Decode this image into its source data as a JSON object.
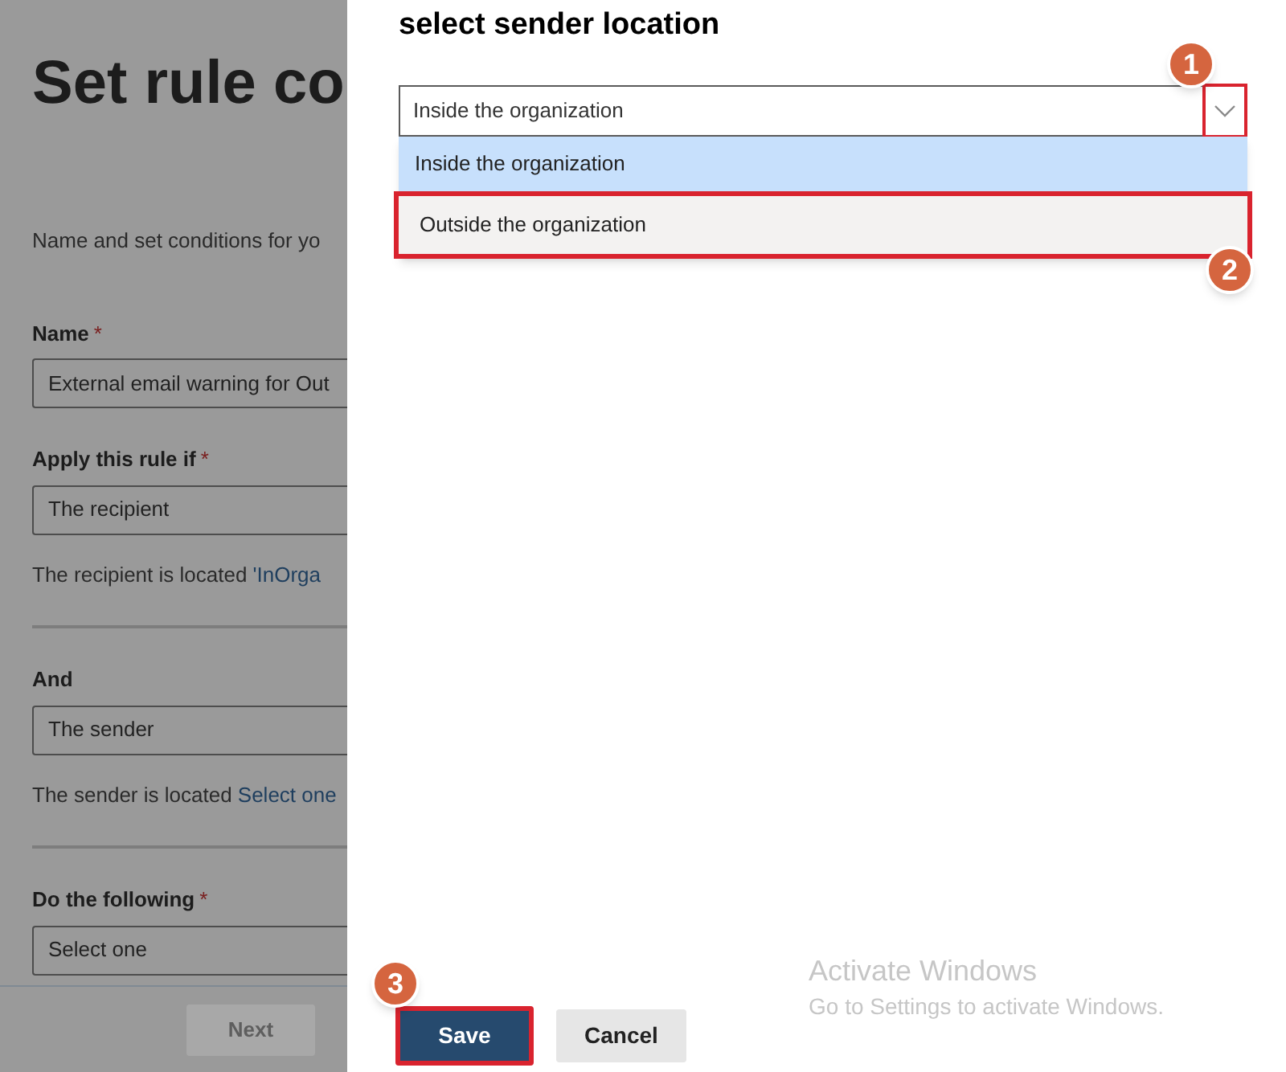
{
  "background_page": {
    "title": "Set rule co",
    "description": "Name and set conditions for yo",
    "required_mark": "*",
    "fields": [
      {
        "label": "Name",
        "required": true,
        "value": "External email warning for Out",
        "divider_after": false
      },
      {
        "label": "Apply this rule if",
        "required": true,
        "value": "The recipient",
        "note": "The recipient is located ",
        "note_link": "'InOrga",
        "divider_after": true
      },
      {
        "label": "And",
        "required": false,
        "value": "The sender",
        "note": "The sender is located ",
        "note_link": "Select one",
        "divider_after": true
      },
      {
        "label": "Do the following",
        "required": true,
        "value": "Select one",
        "divider_after": false
      }
    ],
    "next_button": {
      "label": "Next",
      "disabled": true
    }
  },
  "panel": {
    "title": "select sender location",
    "dropdown": {
      "value": "Inside the organization",
      "expanded": true,
      "callout": "1",
      "options": [
        {
          "label": "Inside the organization",
          "selected": true,
          "hovered": false
        },
        {
          "label": "Outside the organization",
          "selected": false,
          "hovered": true,
          "callout": "2"
        }
      ]
    },
    "buttons": [
      {
        "label": "Save",
        "kind": "primary",
        "callout": "3"
      },
      {
        "label": "Cancel",
        "kind": "secondary"
      }
    ]
  },
  "os_notice": {
    "title": "Activate Windows",
    "text": "Go to Settings to activate Windows."
  }
}
